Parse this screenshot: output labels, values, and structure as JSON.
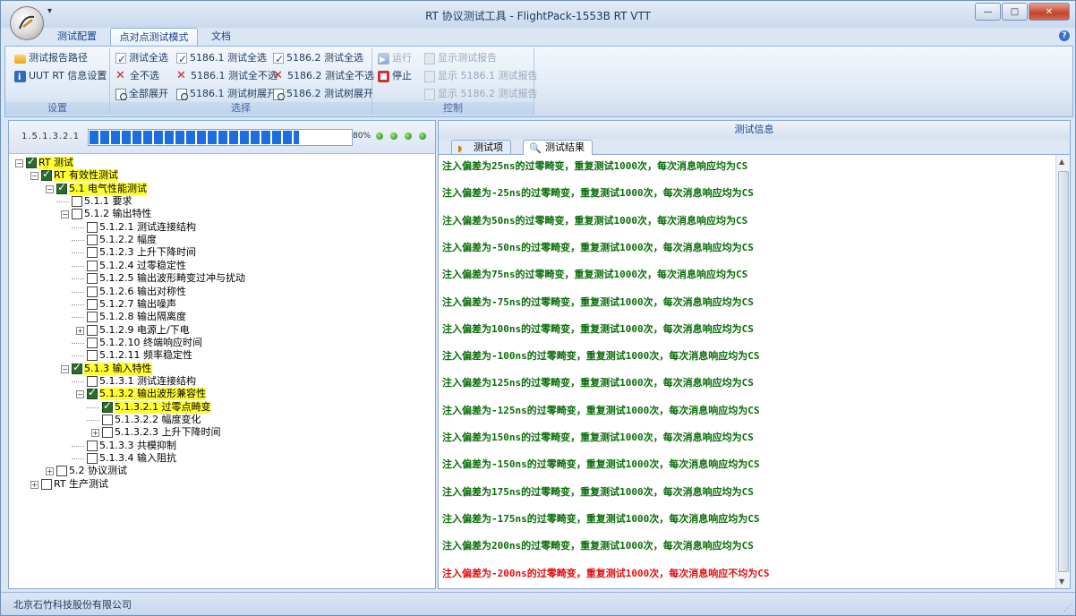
{
  "window": {
    "title": "RT 协议测试工具 - FlightPack-1553B RT VTT",
    "qat_symbol": "▾"
  },
  "window_controls": {
    "minimize": "—",
    "maximize": "□",
    "close": "✕"
  },
  "tabs": [
    {
      "label": "测试配置"
    },
    {
      "label": "点对点测试模式"
    },
    {
      "label": "文档"
    }
  ],
  "help": "?",
  "ribbon": {
    "setup": {
      "label": "设置",
      "items": [
        "测试报告路径",
        "UUT RT 信息设置"
      ]
    },
    "select": {
      "label": "选择",
      "col1": [
        "测试全选",
        "全不选",
        "全部展开"
      ],
      "col2": [
        "5186.1 测试全选",
        "5186.1 测试全不选",
        "5186.1 测试树展开"
      ],
      "col3": [
        "5186.2 测试全选",
        "5186.2 测试全不选",
        "5186.2 测试树展开"
      ]
    },
    "control": {
      "label": "控制",
      "run": "运行",
      "stop": "停止",
      "reports": [
        "显示测试报告",
        "显示 5186.1 测试报告",
        "显示 5186.2 测试报告"
      ]
    }
  },
  "progress": {
    "label": "1.5.1.3.2.1",
    "percent_text": "80%",
    "fraction": 0.8
  },
  "tree": [
    {
      "label": "RT 测试",
      "checked": true,
      "hl": true
    },
    {
      "label": "RT 有效性测试",
      "checked": true,
      "hl": true
    },
    {
      "label": "5.1 电气性能测试",
      "checked": true,
      "hl": true
    },
    {
      "label": "5.1.1 要求",
      "checked": false
    },
    {
      "label": "5.1.2 输出特性",
      "checked": false
    },
    {
      "label": "5.1.2.1 测试连接结构",
      "checked": false
    },
    {
      "label": "5.1.2.2 幅度",
      "checked": false
    },
    {
      "label": "5.1.2.3 上升下降时间",
      "checked": false
    },
    {
      "label": "5.1.2.4 过零稳定性",
      "checked": false
    },
    {
      "label": "5.1.2.5 输出波形畸变过冲与扰动",
      "checked": false
    },
    {
      "label": "5.1.2.6 输出对称性",
      "checked": false
    },
    {
      "label": "5.1.2.7 输出噪声",
      "checked": false
    },
    {
      "label": "5.1.2.8 输出隔离度",
      "checked": false
    },
    {
      "label": "5.1.2.9 电源上/下电",
      "checked": false
    },
    {
      "label": "5.1.2.10 终端响应时间",
      "checked": false
    },
    {
      "label": "5.1.2.11 频率稳定性",
      "checked": false
    },
    {
      "label": "5.1.3 输入特性",
      "checked": true,
      "hl": true
    },
    {
      "label": "5.1.3.1 测试连接结构",
      "checked": false
    },
    {
      "label": "5.1.3.2 输出波形兼容性",
      "checked": true,
      "hl": true
    },
    {
      "label": "5.1.3.2.1 过零点畸变",
      "checked": true,
      "hl": true
    },
    {
      "label": "5.1.3.2.2 幅度变化",
      "checked": false
    },
    {
      "label": "5.1.3.2.3 上升下降时间",
      "checked": false
    },
    {
      "label": "5.1.3.3 共模抑制",
      "checked": false
    },
    {
      "label": "5.1.3.4 输入阻抗",
      "checked": false
    },
    {
      "label": "5.2 协议测试",
      "checked": false
    },
    {
      "label": "RT 生产测试",
      "checked": false
    }
  ],
  "right": {
    "header": "测试信息",
    "tabs": [
      {
        "label": "测试项"
      },
      {
        "label": "测试结果"
      }
    ],
    "log": [
      {
        "text": "注入偏差为25ns的过零畸变，重复测试1000次，每次消息响应均为CS",
        "ok": true
      },
      {
        "text": "注入偏差为-25ns的过零畸变，重复测试1000次，每次消息响应均为CS",
        "ok": true
      },
      {
        "text": "注入偏差为50ns的过零畸变，重复测试1000次，每次消息响应均为CS",
        "ok": true
      },
      {
        "text": "注入偏差为-50ns的过零畸变，重复测试1000次，每次消息响应均为CS",
        "ok": true
      },
      {
        "text": "注入偏差为75ns的过零畸变，重复测试1000次，每次消息响应均为CS",
        "ok": true
      },
      {
        "text": "注入偏差为-75ns的过零畸变，重复测试1000次，每次消息响应均为CS",
        "ok": true
      },
      {
        "text": "注入偏差为100ns的过零畸变，重复测试1000次，每次消息响应均为CS",
        "ok": true
      },
      {
        "text": "注入偏差为-100ns的过零畸变，重复测试1000次，每次消息响应均为CS",
        "ok": true
      },
      {
        "text": "注入偏差为125ns的过零畸变，重复测试1000次，每次消息响应均为CS",
        "ok": true
      },
      {
        "text": "注入偏差为-125ns的过零畸变，重复测试1000次，每次消息响应均为CS",
        "ok": true
      },
      {
        "text": "注入偏差为150ns的过零畸变，重复测试1000次，每次消息响应均为CS",
        "ok": true
      },
      {
        "text": "注入偏差为-150ns的过零畸变，重复测试1000次，每次消息响应均为CS",
        "ok": true
      },
      {
        "text": "注入偏差为175ns的过零畸变，重复测试1000次，每次消息响应均为CS",
        "ok": true
      },
      {
        "text": "注入偏差为-175ns的过零畸变，重复测试1000次，每次消息响应均为CS",
        "ok": true
      },
      {
        "text": "注入偏差为200ns的过零畸变，重复测试1000次，每次消息响应均为CS",
        "ok": true
      },
      {
        "text": "注入偏差为-200ns的过零畸变，重复测试1000次，每次消息响应不均为CS",
        "ok": false
      }
    ]
  },
  "colors": {
    "ok": "#0a6e0a",
    "error": "#e01010",
    "highlight": "#ffff33",
    "progress": "#1b6ee0"
  },
  "status": {
    "company": "北京石竹科技股份有限公司"
  }
}
